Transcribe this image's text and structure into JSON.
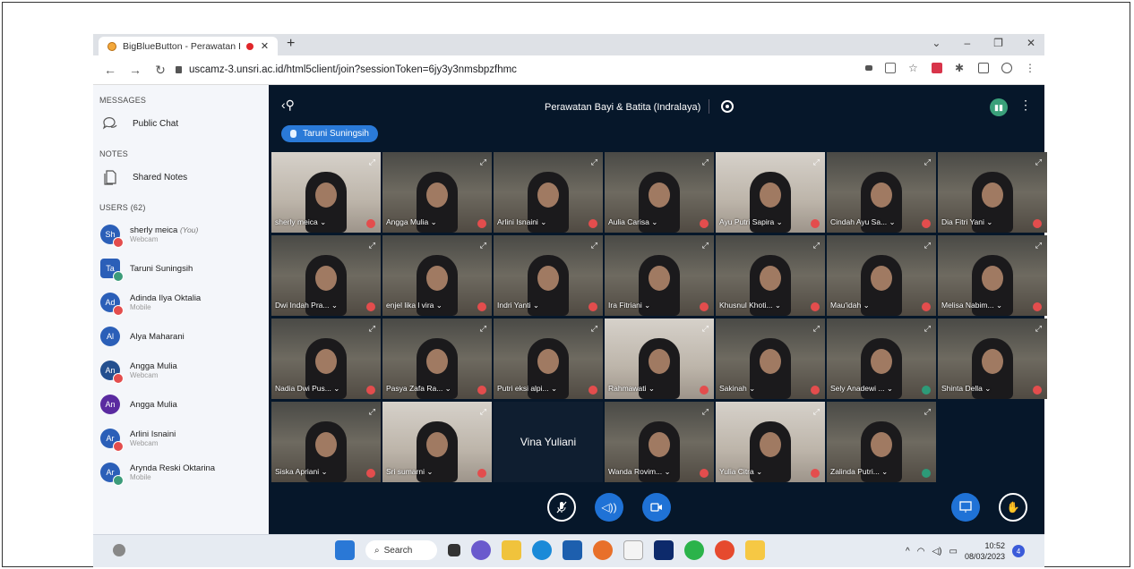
{
  "browser": {
    "tab_title": "BigBlueButton - Perawatan I",
    "url": "uscamz-3.unsri.ac.id/html5client/join?sessionToken=6jy3y3nmsbpzfhmc"
  },
  "sidebar": {
    "messages_title": "MESSAGES",
    "public_chat": "Public Chat",
    "notes_title": "NOTES",
    "shared_notes": "Shared Notes",
    "users_title": "USERS (62)",
    "users": [
      {
        "initials": "Sh",
        "name": "sherly meica",
        "you": "(You)",
        "sub": "Webcam",
        "color": "#2b5fb8",
        "square": false,
        "badge": "red"
      },
      {
        "initials": "Ta",
        "name": "Taruni Suningsih",
        "you": "",
        "sub": "",
        "color": "#2b5fb8",
        "square": true,
        "badge": "green"
      },
      {
        "initials": "Ad",
        "name": "Adinda Ilya Oktalia",
        "you": "",
        "sub": "Mobile",
        "color": "#2b5fb8",
        "square": false,
        "badge": "red"
      },
      {
        "initials": "Al",
        "name": "Alya Maharani",
        "you": "",
        "sub": "",
        "color": "#2b5fb8",
        "square": false,
        "badge": ""
      },
      {
        "initials": "An",
        "name": "Angga Mulia",
        "you": "",
        "sub": "Webcam",
        "color": "#234f8f",
        "square": false,
        "badge": "red"
      },
      {
        "initials": "An",
        "name": "Angga Mulia",
        "you": "",
        "sub": "",
        "color": "#5a2aa0",
        "square": false,
        "badge": ""
      },
      {
        "initials": "Ar",
        "name": "Arlini Isnaini",
        "you": "",
        "sub": "Webcam",
        "color": "#2b5fb8",
        "square": false,
        "badge": "red"
      },
      {
        "initials": "Ar",
        "name": "Arynda Reski Oktarina",
        "you": "",
        "sub": "Mobile",
        "color": "#2b5fb8",
        "square": false,
        "badge": "green"
      }
    ]
  },
  "main": {
    "title": "Perawatan Bayi & Batita (Indralaya)",
    "talking": "Taruni Suningsih",
    "tiles": [
      {
        "name": "sherly meica",
        "mic": "red",
        "style": "bright"
      },
      {
        "name": "Angga Mulia",
        "mic": "red",
        "style": ""
      },
      {
        "name": "Arlini Isnaini",
        "mic": "red",
        "style": ""
      },
      {
        "name": "Aulia Carisa",
        "mic": "red",
        "style": ""
      },
      {
        "name": "Ayu Putri Sapira",
        "mic": "red",
        "style": "bright"
      },
      {
        "name": "Cindah Ayu Sa...",
        "mic": "red",
        "style": ""
      },
      {
        "name": "Dia Fitri Yani",
        "mic": "red",
        "style": ""
      },
      {
        "name": "Dwi Indah Pra...",
        "mic": "red",
        "style": ""
      },
      {
        "name": "enjel lika l vira",
        "mic": "red",
        "style": ""
      },
      {
        "name": "Indri Yanti",
        "mic": "red",
        "style": ""
      },
      {
        "name": "Ira Fitriani",
        "mic": "red",
        "style": ""
      },
      {
        "name": "Khusnul Khoti...",
        "mic": "red",
        "style": ""
      },
      {
        "name": "Mau'idah",
        "mic": "red",
        "style": ""
      },
      {
        "name": "Melisa Nabim...",
        "mic": "red",
        "style": ""
      },
      {
        "name": "Nadia Dwi Pus...",
        "mic": "red",
        "style": ""
      },
      {
        "name": "Pasya Zafa Ra...",
        "mic": "red",
        "style": ""
      },
      {
        "name": "Putri eksi alpi...",
        "mic": "red",
        "style": ""
      },
      {
        "name": "Rahmawati",
        "mic": "red",
        "style": "bright"
      },
      {
        "name": "Sakinah",
        "mic": "red",
        "style": ""
      },
      {
        "name": "Sely Anadewi ...",
        "mic": "green",
        "style": ""
      },
      {
        "name": "Shinta Della",
        "mic": "red",
        "style": ""
      },
      {
        "name": "Siska Apriani",
        "mic": "red",
        "style": ""
      },
      {
        "name": "Sri sumarni",
        "mic": "red",
        "style": "bright"
      },
      {
        "name": "Vina Yuliani",
        "mic": "",
        "style": "dark"
      },
      {
        "name": "Wanda Rovim...",
        "mic": "red",
        "style": ""
      },
      {
        "name": "Yulia Citra",
        "mic": "red",
        "style": "bright"
      },
      {
        "name": "Zalinda Putri...",
        "mic": "green",
        "style": ""
      }
    ]
  },
  "taskbar": {
    "search": "Search",
    "time": "10:52",
    "date": "08/03/2023",
    "notifications": "4"
  },
  "colors": {
    "main_bg": "#06172a",
    "accent": "#1f72d6",
    "mic_off": "#e34d4d"
  }
}
